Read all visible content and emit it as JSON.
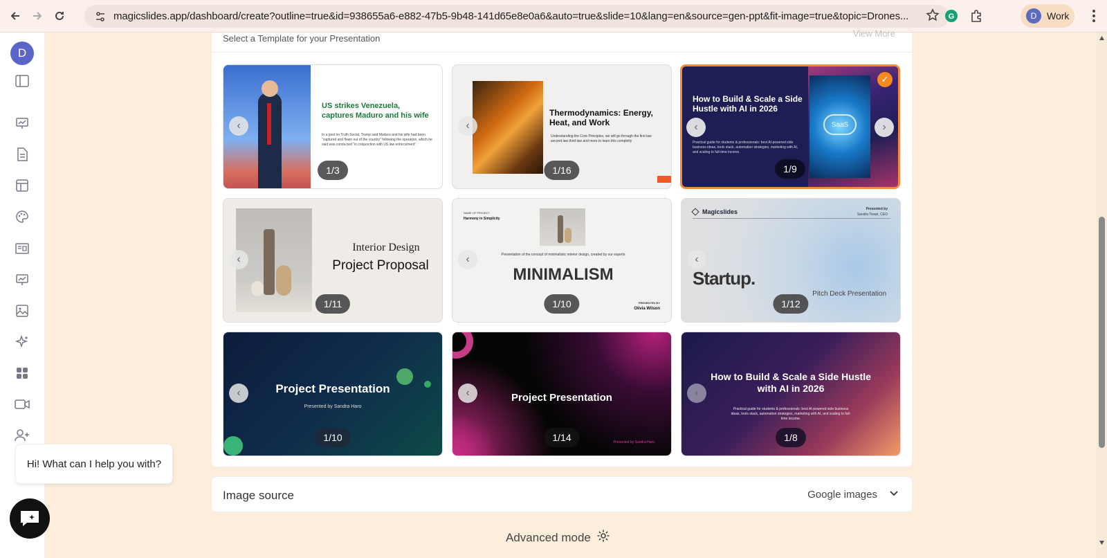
{
  "browser": {
    "url": "magicslides.app/dashboard/create?outline=true&id=938655a6-e882-47b5-9b48-141d65e8e0a6&auto=true&slide=10&lang=en&source=gen-ppt&fit-image=true&topic=Drones...",
    "profile_initial": "D",
    "profile_label": "Work"
  },
  "sidebar": {
    "avatar_initial": "D",
    "icons": [
      "panel-toggle-icon",
      "presentation-icon",
      "document-icon",
      "template-icon",
      "palette-icon",
      "slides-list-icon",
      "chart-presentation-icon",
      "image-icon",
      "sparkle-icon",
      "apps-icon",
      "video-icon",
      "add-user-icon"
    ]
  },
  "panel": {
    "subtitle": "Select a Template for your Presentation",
    "view_more": "View More"
  },
  "templates": [
    {
      "title": "US strikes Venezuela, captures Maduro and his wife",
      "body": "In a post on Truth Social, Trump said Maduro and his wife had been \"captured and flown out of the country\" following the operation, which he said was conducted \"in conjunction with US law enforcement\".",
      "counter": "1/3",
      "selected": false
    },
    {
      "title": "Thermodynamics: Energy, Heat, and Work",
      "body": "Understanding the Core Principles, we will go through the first law second law third law and more to learn this completly",
      "counter": "1/16",
      "selected": false
    },
    {
      "title": "How to Build & Scale a Side Hustle with AI in 2026",
      "body": "Practical guide for students & professionals: best AI-powered side business ideas, tools stack, automation strategies, marketing with AI, and scaling to full-time income.",
      "counter": "1/9",
      "selected": true,
      "badge": "SaaS"
    },
    {
      "title_small": "Interior Design",
      "title": "Project Proposal",
      "counter": "1/11",
      "selected": false
    },
    {
      "kicker": "NAME OF PROJECT",
      "kicker2": "Harmony in Simplicity",
      "desc": "Presentation of the concept of minimalistic interior design, created by our experts",
      "title": "MINIMALISM",
      "presented": "PRESENTED BY",
      "author": "Olivia Wilson",
      "counter": "1/10",
      "selected": false
    },
    {
      "brand": "Magicslides",
      "presented": "Presented by",
      "author": "Sandra Tiwari, CEO",
      "title": "Startup.",
      "subtitle": "Pitch Deck Presentation",
      "counter": "1/12",
      "selected": false
    },
    {
      "title": "Project Presentation",
      "sub": "Presented by Sandra Haro",
      "counter": "1/10",
      "selected": false
    },
    {
      "title": "Project Presentation",
      "sub": "Presented by Sandra Haro",
      "counter": "1/14",
      "selected": false
    },
    {
      "title": "How to Build & Scale a Side Hustle with AI in 2026",
      "body": "Practical guide for students & professionals: best AI-powered side business ideas, tools stack, automation strategies, marketing with AI, and scaling to full-time income.",
      "counter": "1/8",
      "selected": false
    }
  ],
  "image_source": {
    "label": "Image source",
    "value": "Google images"
  },
  "advanced_mode": {
    "label": "Advanced mode"
  },
  "chat": {
    "message": "Hi! What can I help you with?"
  }
}
